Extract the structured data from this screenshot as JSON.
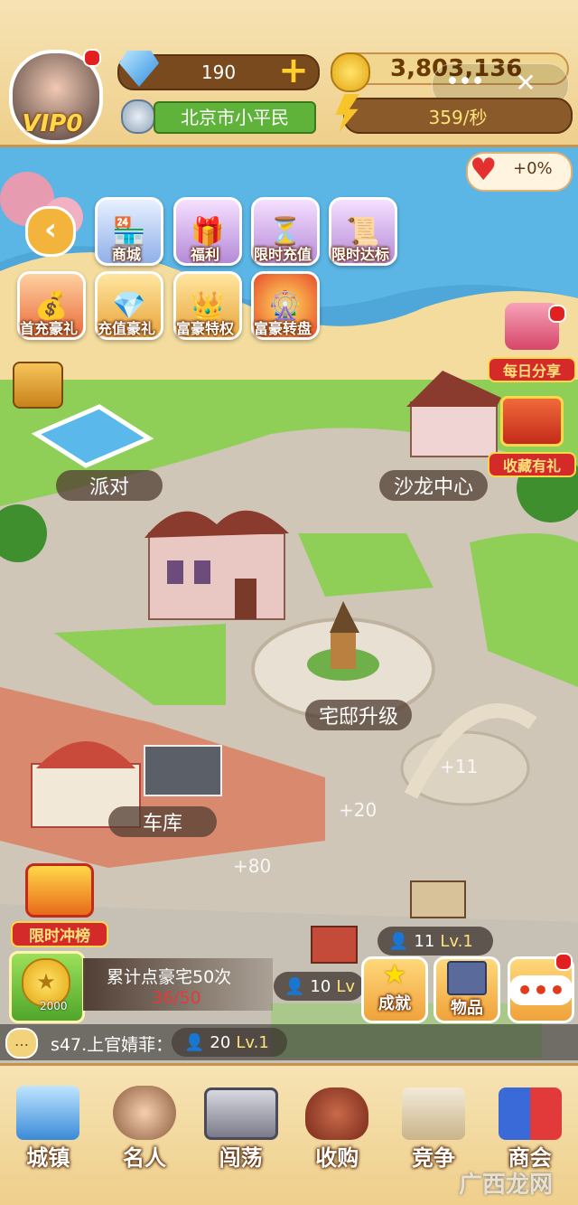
{
  "top": {
    "vip_label": "VIP0",
    "diamonds": "190",
    "coins": "3,803,136",
    "title_rank": "北京市小平民",
    "income_rate": "359/秒",
    "menu_dots": "•••",
    "close": "✕"
  },
  "happiness": {
    "value": "+0%"
  },
  "menu_row1": [
    {
      "label": "商城",
      "icon": "shop-icon"
    },
    {
      "label": "福利",
      "icon": "gift-icon"
    },
    {
      "label": "限时充值",
      "icon": "hourglass-gift-icon"
    },
    {
      "label": "限时达标",
      "icon": "hourglass-scroll-icon"
    }
  ],
  "menu_row2": [
    {
      "label": "首充豪礼",
      "icon": "money-chest-icon"
    },
    {
      "label": "充值豪礼",
      "icon": "crystal-crown-icon"
    },
    {
      "label": "富豪特权",
      "icon": "vip-crown-icon"
    },
    {
      "label": "富豪转盘",
      "icon": "wheel-icon"
    }
  ],
  "side": {
    "daily_share": "每日分享",
    "favorite_gift": "收藏有礼",
    "rank_event": "限时冲榜"
  },
  "map_labels": {
    "party": "派对",
    "salon": "沙龙中心",
    "mansion_upgrade": "宅邸升级",
    "garage": "车库"
  },
  "floating": {
    "plus11": "+11",
    "plus20": "+20",
    "plus80": "+80"
  },
  "shops": [
    {
      "count": "11",
      "level": "Lv.1"
    },
    {
      "count": "10",
      "level": "Lv"
    },
    {
      "count": "20",
      "level": "Lv.1"
    }
  ],
  "quest": {
    "text": "累计点豪宅50次",
    "progress": "36/50",
    "reward": "2000"
  },
  "actions": {
    "achievement": "成就",
    "items": "物品",
    "more": "•••"
  },
  "chat": {
    "message": "s47.上官婧菲："
  },
  "nav": [
    {
      "label": "城镇",
      "icon": "city-icon"
    },
    {
      "label": "名人",
      "icon": "celebrity-icon"
    },
    {
      "label": "闯荡",
      "icon": "briefcase-icon"
    },
    {
      "label": "收购",
      "icon": "money-bag-icon"
    },
    {
      "label": "竞争",
      "icon": "stamp-icon"
    },
    {
      "label": "商会",
      "icon": "chamber-flag-icon"
    }
  ],
  "watermark": "广西龙网",
  "colors": {
    "gold": "#ffe27a",
    "bar_brown": "#7a4a1f",
    "green_rank": "#5fb33a",
    "red_badge": "#e32020"
  }
}
